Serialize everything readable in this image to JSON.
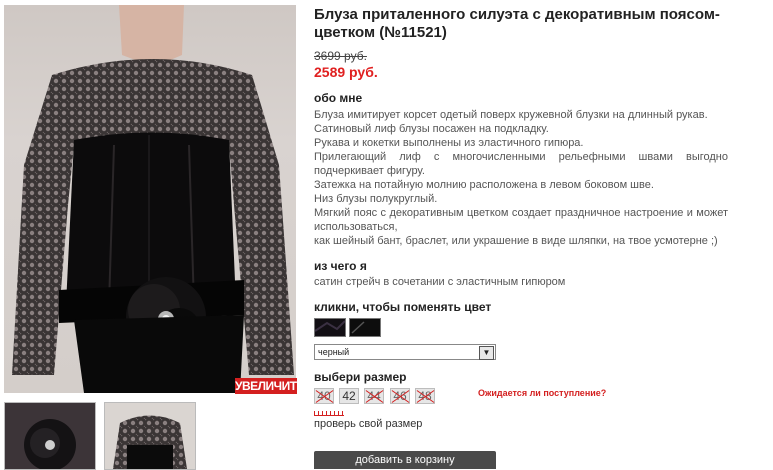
{
  "product": {
    "title": "Блуза приталенного силуэта с декоративным поясом-цветком (№11521)",
    "old_price": "3699 руб.",
    "new_price": "2589 руб."
  },
  "gallery": {
    "zoom_label": "УВЕЛИЧИТЬ"
  },
  "about": {
    "heading": "обо мне",
    "lines": [
      "Блуза имитирует корсет одетый поверх кружевной блузки на длинный рукав.",
      "Сатиновый лиф блузы посажен на подкладку.",
      "Рукава и кокетки выполнены из эластичного гипюра.",
      "Прилегающий лиф с многочисленными рельефными швами выгодно подчеркивает фигуру.",
      "Затежка на потайную молнию расположена в левом боковом шве.",
      "Низ блузы полукруглый.",
      "Мягкий пояс с декоративным цветком создает праздничное настроение и может использоваться,",
      "как шейный бант, браслет, или украшение в виде шляпки, на твое усмотерне ;)"
    ]
  },
  "material": {
    "heading": "из чего я",
    "text": "сатин стрейч в сочетании с эластичным гипюром"
  },
  "color": {
    "heading": "кликни, чтобы поменять цвет",
    "selected": "черный"
  },
  "size": {
    "heading": "выбери размер",
    "options": [
      "40",
      "42",
      "44",
      "46",
      "48"
    ],
    "waitlist_label": "Ожидается ли поступление?",
    "check_label": "проверь свой размер"
  },
  "cart": {
    "add_label": "добавить в корзину"
  },
  "colors": {
    "accent_red": "#e02020",
    "cart_button": "#4a4a4a"
  }
}
